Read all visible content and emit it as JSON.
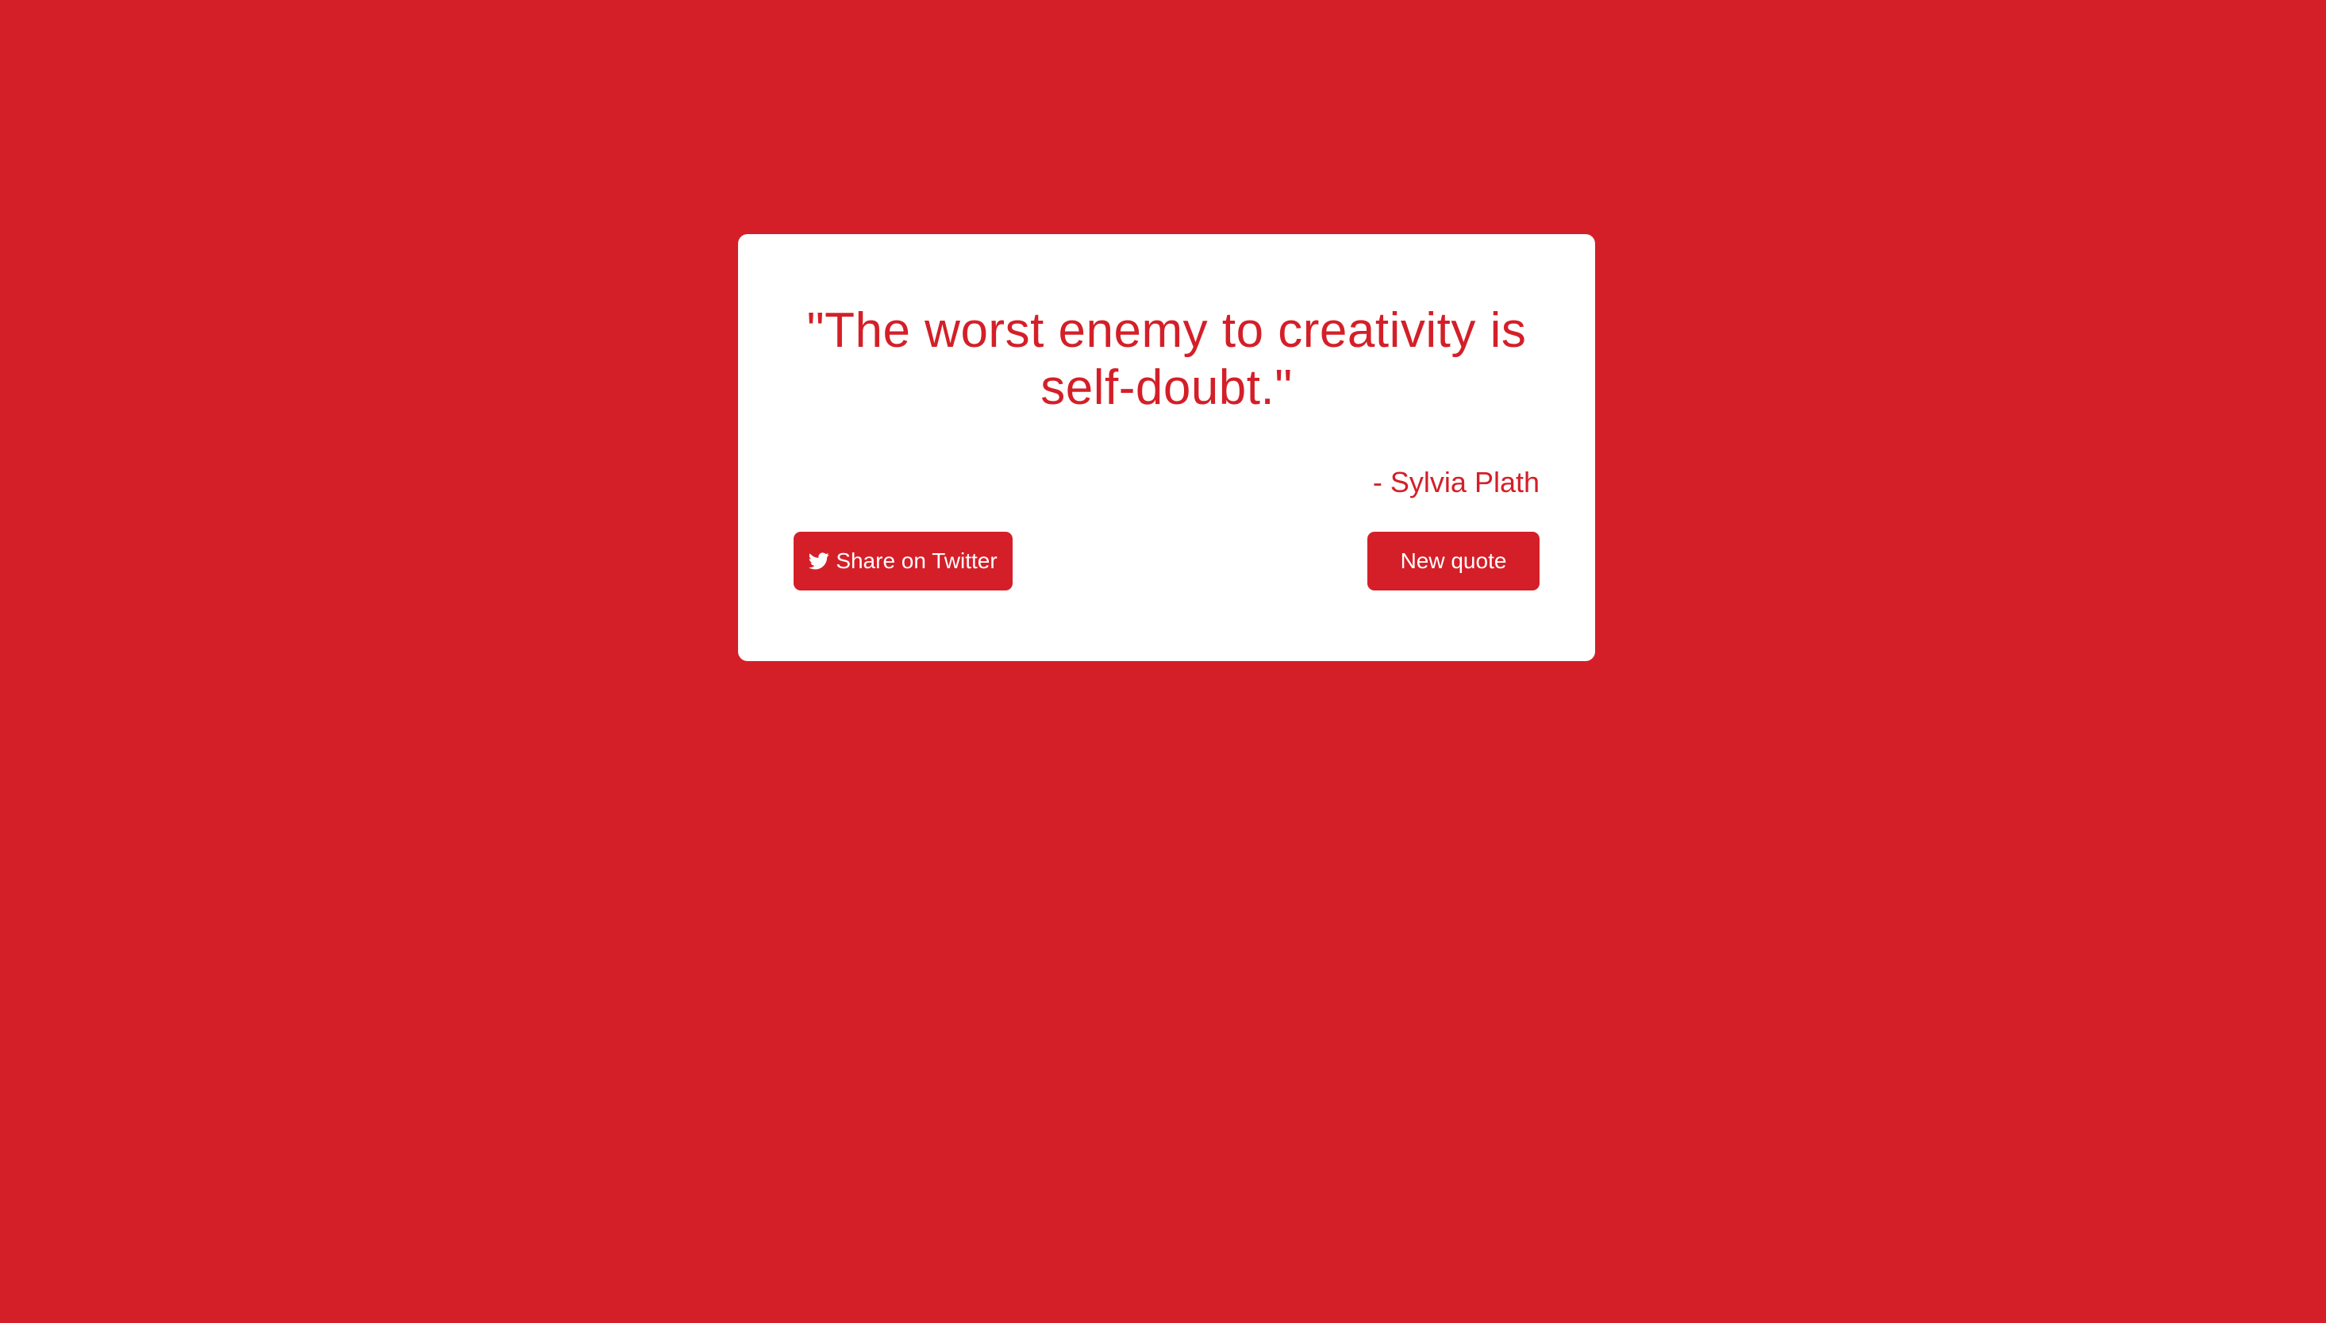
{
  "theme": {
    "background_color": "#d41f28",
    "card_color": "#ffffff",
    "accent_color": "#d41f28",
    "button_text_color": "#ffffff"
  },
  "quote": {
    "text": "\"The worst enemy to creativity is self-doubt.\"",
    "author": "- Sylvia Plath"
  },
  "actions": {
    "twitter_icon": "twitter-bird-icon",
    "twitter_label": "Share on Twitter",
    "new_quote_label": "New quote"
  }
}
